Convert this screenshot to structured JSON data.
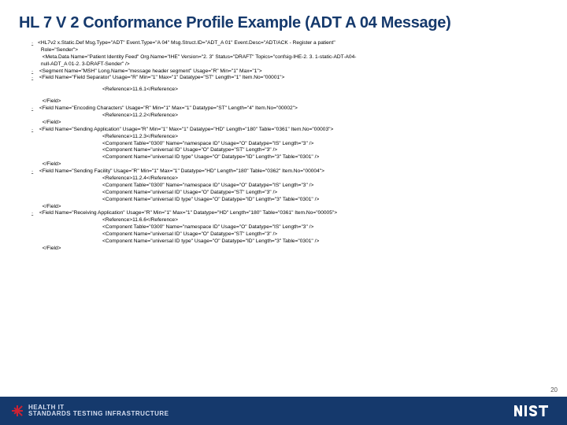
{
  "title": "HL 7 V 2 Conformance Profile Example (ADT A 04 Message)",
  "xml": {
    "l01_dash": "-",
    "l01": "<HL7v2 x.Static.Def Msg.Type=\"ADT\" Event.Type=\"A 04\" Msg.Struct.ID=\"ADT_A 01\" Event.Desc=\"ADT/ACK - Register a patient\"",
    "l02": " Role=\"Sender\">",
    "l03": "  <Meta.Data Name=\"Patient Identity Feed\" Org.Name=\"IHE\" Version=\"2. 3\" Status=\"DRAFT\" Topics=\"confsig-IHE-2. 3. 1-static-ADT-A04-",
    "l04": " null-ADT_A 01-2. 3-DRAFT-Sender\" />",
    "l05_dash": "-",
    "l05": " <Segment Name=\"MSH\" Long.Name=\"message header segment\" Usage=\"R\" Min=\"1\" Max=\"1\">",
    "l06_dash": "-",
    "l06": " <Field Name=\"Field Separator\" Usage=\"R\" Min=\"1\" Max=\"1\" Datatype=\"ST\" Length=\"1\" Item.No=\"00001\">",
    "l07": "<Reference>11.6.1</Reference>",
    "l08": "  </Field>",
    "l09_dash": "-",
    "l09": " <Field Name=\"Encoding Characters\" Usage=\"R\" Min=\"1\" Max=\"1\" Datatype=\"ST\" Length=\"4\" Item.No=\"00002\">",
    "l10": "<Reference>11.2.2</Reference>",
    "l11": "  </Field>",
    "l12_dash": "-",
    "l12": " <Field Name=\"Sending Application\" Usage=\"R\" Min=\"1\" Max=\"1\" Datatype=\"HD\" Length=\"180\" Table=\"0361\" Item.No=\"00003\">",
    "l13": "<Reference>11.2.3</Reference>",
    "l14": "<Component Table=\"0300\" Name=\"namespace ID\" Usage=\"O\" Datatype=\"IS\" Length=\"3\" />",
    "l15": "<Component Name=\"universal ID\" Usage=\"O\" Datatype=\"ST\" Length=\"3\" />",
    "l16": "<Component Name=\"universal ID type\" Usage=\"O\" Datatype=\"ID\" Length=\"3\" Table=\"0301\" />",
    "l17": "  </Field>",
    "l18_dash": "-",
    "l18": " <Field Name=\"Sending Facility\" Usage=\"R\" Min=\"1\" Max=\"1\" Datatype=\"HD\" Length=\"180\" Table=\"0362\" Item.No=\"00004\">",
    "l19": "<Reference>11.2.4</Reference>",
    "l20": "<Component Table=\"0300\" Name=\"namespace ID\" Usage=\"O\" Datatype=\"IS\" Length=\"3\" />",
    "l21": "<Component Name=\"universal ID\" Usage=\"O\" Datatype=\"ST\" Length=\"3\" />",
    "l22": "<Component Name=\"universal ID type\" Usage=\"O\" Datatype=\"ID\" Length=\"3\" Table=\"0301\" />",
    "l23": "  </Field>",
    "l24_dash": "-",
    "l24": " <Field Name=\"Receiving Application\" Usage=\"R\" Min=\"1\" Max=\"1\" Datatype=\"HD\" Length=\"180\" Table=\"0361\" Item.No=\"00005\">",
    "l25": "<Reference>11.6.6</Reference>",
    "l26": "<Component Table=\"0300\" Name=\"namespace ID\" Usage=\"O\" Datatype=\"IS\" Length=\"3\" />",
    "l27": "<Component Name=\"universal ID\" Usage=\"O\" Datatype=\"ST\" Length=\"3\" />",
    "l28": "<Component Name=\"universal ID type\" Usage=\"O\" Datatype=\"ID\" Length=\"3\" Table=\"0301\" />",
    "l29": "  </Field>"
  },
  "footer": {
    "line1": "HEALTH IT",
    "line2": "STANDARDS TESTING INFRASTRUCTURE"
  },
  "pagenum": "20"
}
